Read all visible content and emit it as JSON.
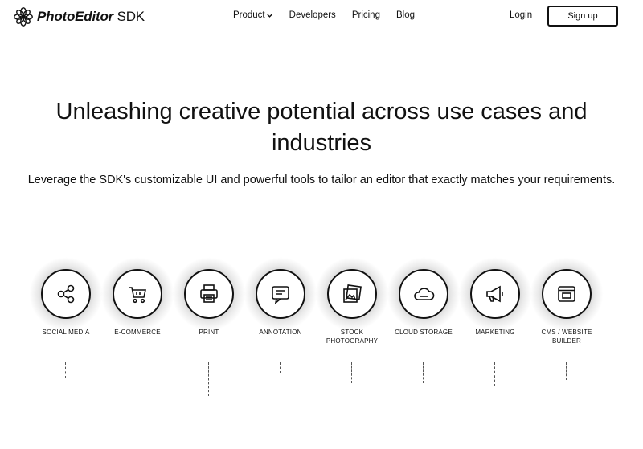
{
  "header": {
    "logo": {
      "name_main": "PhotoEditor",
      "name_suffix": " SDK",
      "icon": "flower-logo-icon"
    },
    "nav": [
      {
        "label": "Product",
        "icon": "chevron-down-icon"
      },
      {
        "label": "Developers"
      },
      {
        "label": "Pricing"
      },
      {
        "label": "Blog"
      }
    ],
    "login_label": "Login",
    "signup_label": "Sign up"
  },
  "hero": {
    "title": "Unleashing creative potential across use cases and industries",
    "subtitle": "Leverage the SDK's customizable UI and powerful tools to tailor an editor that exactly matches your requirements."
  },
  "use_cases": [
    {
      "label": "SOCIAL MEDIA",
      "icon": "share-nodes-icon"
    },
    {
      "label": "E-COMMERCE",
      "icon": "shopping-cart-icon"
    },
    {
      "label": "PRINT",
      "icon": "printer-icon"
    },
    {
      "label": "ANNOTATION",
      "icon": "annotation-icon"
    },
    {
      "label": "STOCK PHOTOGRAPHY",
      "icon": "photo-stack-icon"
    },
    {
      "label": "CLOUD STORAGE",
      "icon": "cloud-icon"
    },
    {
      "label": "MARKETING",
      "icon": "megaphone-icon"
    },
    {
      "label": "CMS / WEBSITE BUILDER",
      "icon": "browser-window-icon"
    }
  ],
  "colors": {
    "text": "#111111",
    "background": "#ffffff"
  }
}
